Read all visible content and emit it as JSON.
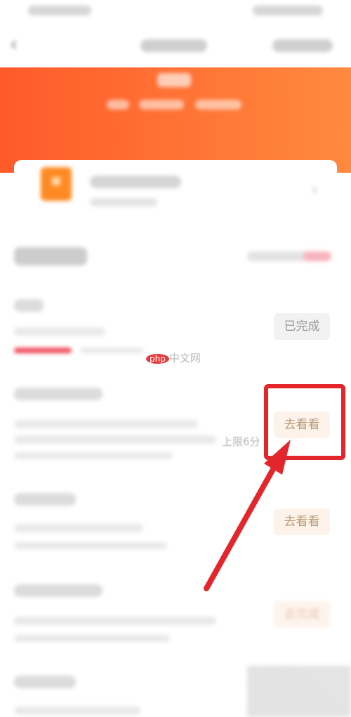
{
  "tasks": [
    {
      "button_label": "已完成"
    },
    {
      "button_label": "去看看",
      "note": "上限6分"
    },
    {
      "button_label": "去看看"
    },
    {
      "button_label": "去完成"
    }
  ],
  "watermark": {
    "logo": "php",
    "text": "中文网"
  },
  "colors": {
    "accent": "#ff5a2a",
    "highlight": "#e3262c",
    "progress": "#f04e5e"
  }
}
